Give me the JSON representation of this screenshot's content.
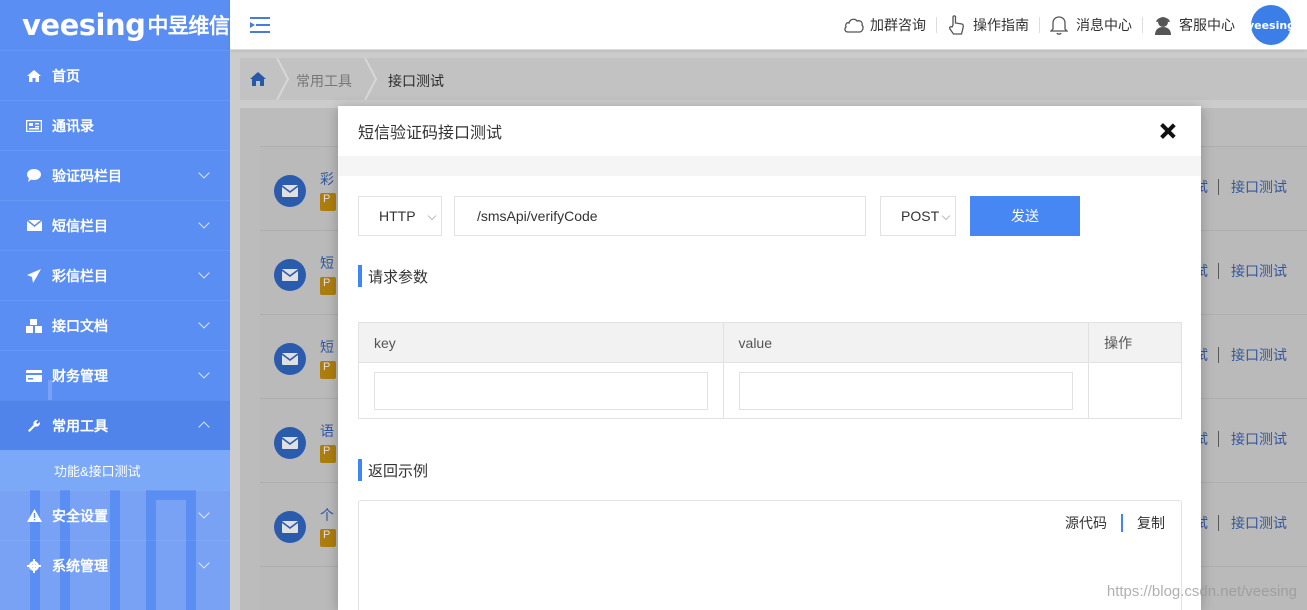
{
  "app": {
    "logo_brand": "veesing",
    "logo_cn": "中昱维信",
    "avatar_text": "veesing"
  },
  "sidebar": {
    "items": [
      {
        "label": "首页",
        "icon": "home-icon"
      },
      {
        "label": "通讯录",
        "icon": "contact-card-icon"
      },
      {
        "label": "验证码栏目",
        "icon": "chat-bubble-icon"
      },
      {
        "label": "短信栏目",
        "icon": "envelope-icon"
      },
      {
        "label": "彩信栏目",
        "icon": "paper-plane-icon"
      },
      {
        "label": "接口文档",
        "icon": "cubes-icon"
      },
      {
        "label": "财务管理",
        "icon": "credit-card-icon"
      },
      {
        "label": "常用工具",
        "icon": "wrench-icon"
      },
      {
        "label": "安全设置",
        "icon": "warning-icon"
      },
      {
        "label": "系统管理",
        "icon": "gear-icon"
      }
    ],
    "active_submenu": "功能&接口测试"
  },
  "header": {
    "links": [
      {
        "label": "加群咨询",
        "icon": "cloud-chat-icon"
      },
      {
        "label": "操作指南",
        "icon": "hand-pointer-icon"
      },
      {
        "label": "消息中心",
        "icon": "bell-icon"
      },
      {
        "label": "客服中心",
        "icon": "support-agent-icon"
      }
    ]
  },
  "breadcrumb": {
    "items": [
      "常用工具",
      "接口测试"
    ]
  },
  "background_list": {
    "rows": [
      {
        "title": "彩",
        "badge": "P",
        "link_a": "试",
        "link_b": "接口测试"
      },
      {
        "title": "短",
        "badge": "P",
        "link_a": "试",
        "link_b": "接口测试"
      },
      {
        "title": "短",
        "badge": "P",
        "link_a": "试",
        "link_b": "接口测试"
      },
      {
        "title": "语",
        "badge": "P",
        "link_a": "试",
        "link_b": "接口测试"
      },
      {
        "title": "个",
        "badge": "P",
        "link_a": "试",
        "link_b": "接口测试"
      }
    ]
  },
  "modal": {
    "title": "短信验证码接口测试",
    "protocol": "HTTP",
    "url": "/smsApi/verifyCode",
    "method": "POST",
    "send_label": "发送",
    "params_title": "请求参数",
    "table_headers": {
      "key": "key",
      "value": "value",
      "action": "操作"
    },
    "response_title": "返回示例",
    "source_label": "源代码",
    "copy_label": "复制"
  },
  "watermark": "https://blog.csdn.net/veesing",
  "colors": {
    "sidebar": "#5b8ef2",
    "accent": "#4687f4",
    "section_bar": "#3d86f5"
  }
}
